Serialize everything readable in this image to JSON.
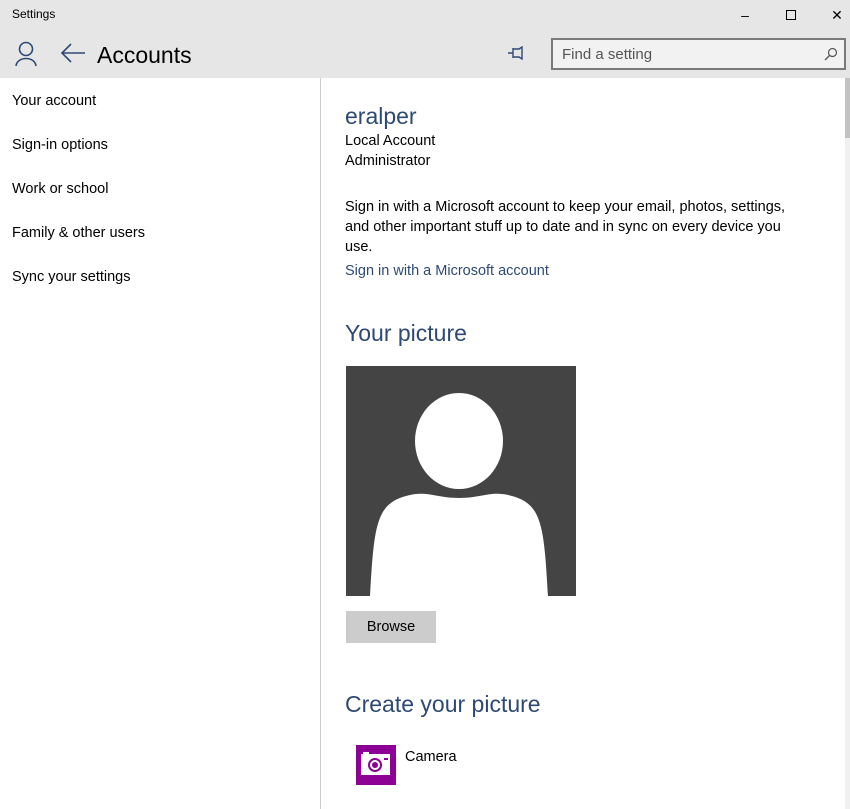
{
  "window": {
    "title": "Settings"
  },
  "header": {
    "title": "Accounts",
    "search_placeholder": "Find a setting"
  },
  "sidebar": {
    "items": [
      {
        "label": "Your account"
      },
      {
        "label": "Sign-in options"
      },
      {
        "label": "Work or school"
      },
      {
        "label": "Family & other users"
      },
      {
        "label": "Sync your settings"
      }
    ]
  },
  "account": {
    "name": "eralper",
    "type": "Local Account",
    "role": "Administrator",
    "description": "Sign in with a Microsoft account to keep your email, photos, settings, and other important stuff up to date and in sync on every device you use.",
    "link": "Sign in with a Microsoft account"
  },
  "picture": {
    "heading": "Your picture",
    "browse_label": "Browse"
  },
  "create": {
    "heading": "Create your picture",
    "items": [
      {
        "label": "Camera",
        "icon": "camera-icon",
        "color": "#8c0095"
      }
    ]
  },
  "colors": {
    "accent": "#2e4a74",
    "chrome": "#e6e6e6",
    "avatar_bg": "#444444"
  }
}
